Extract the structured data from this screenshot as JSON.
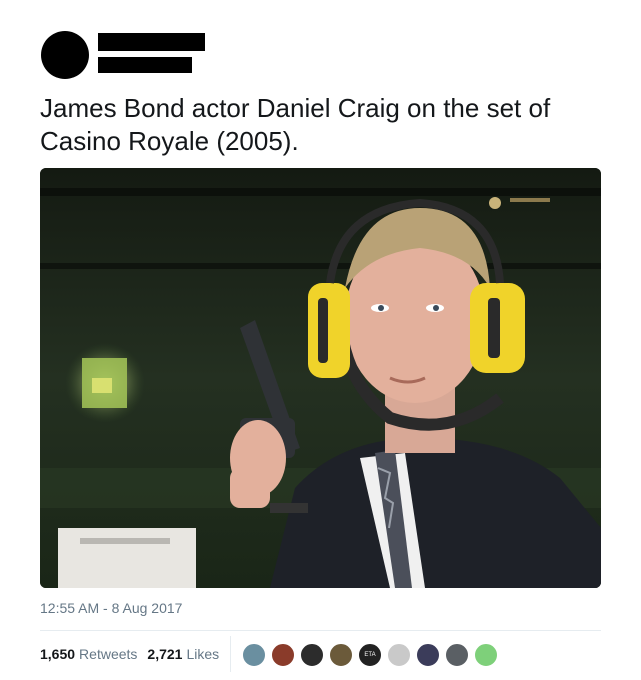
{
  "tweet": {
    "text": "James Bond actor Daniel Craig on the set of Casino Royale (2005).",
    "timestamp": "12:55 AM - 8 Aug 2017"
  },
  "stats": {
    "retweets_count": "1,650",
    "retweets_label": "Retweets",
    "likes_count": "2,721",
    "likes_label": "Likes"
  },
  "likers": [
    {
      "icon": "liker-avatar-1",
      "color": "#6a8fa0"
    },
    {
      "icon": "liker-avatar-2",
      "color": "#8a3b2a"
    },
    {
      "icon": "liker-avatar-3",
      "color": "#2c2c2c"
    },
    {
      "icon": "liker-avatar-4",
      "color": "#6b5a3a"
    },
    {
      "icon": "liker-avatar-5",
      "color": "#222222",
      "text": "ETA"
    },
    {
      "icon": "liker-avatar-6",
      "color": "#c9c9c9"
    },
    {
      "icon": "liker-avatar-7",
      "color": "#3b3c5a"
    },
    {
      "icon": "liker-avatar-8",
      "color": "#5a5f64"
    },
    {
      "icon": "liker-avatar-9",
      "color": "#7ed07a"
    }
  ],
  "colors": {
    "text": "#14171a",
    "muted": "#657786",
    "divider": "#e6ecf0"
  }
}
